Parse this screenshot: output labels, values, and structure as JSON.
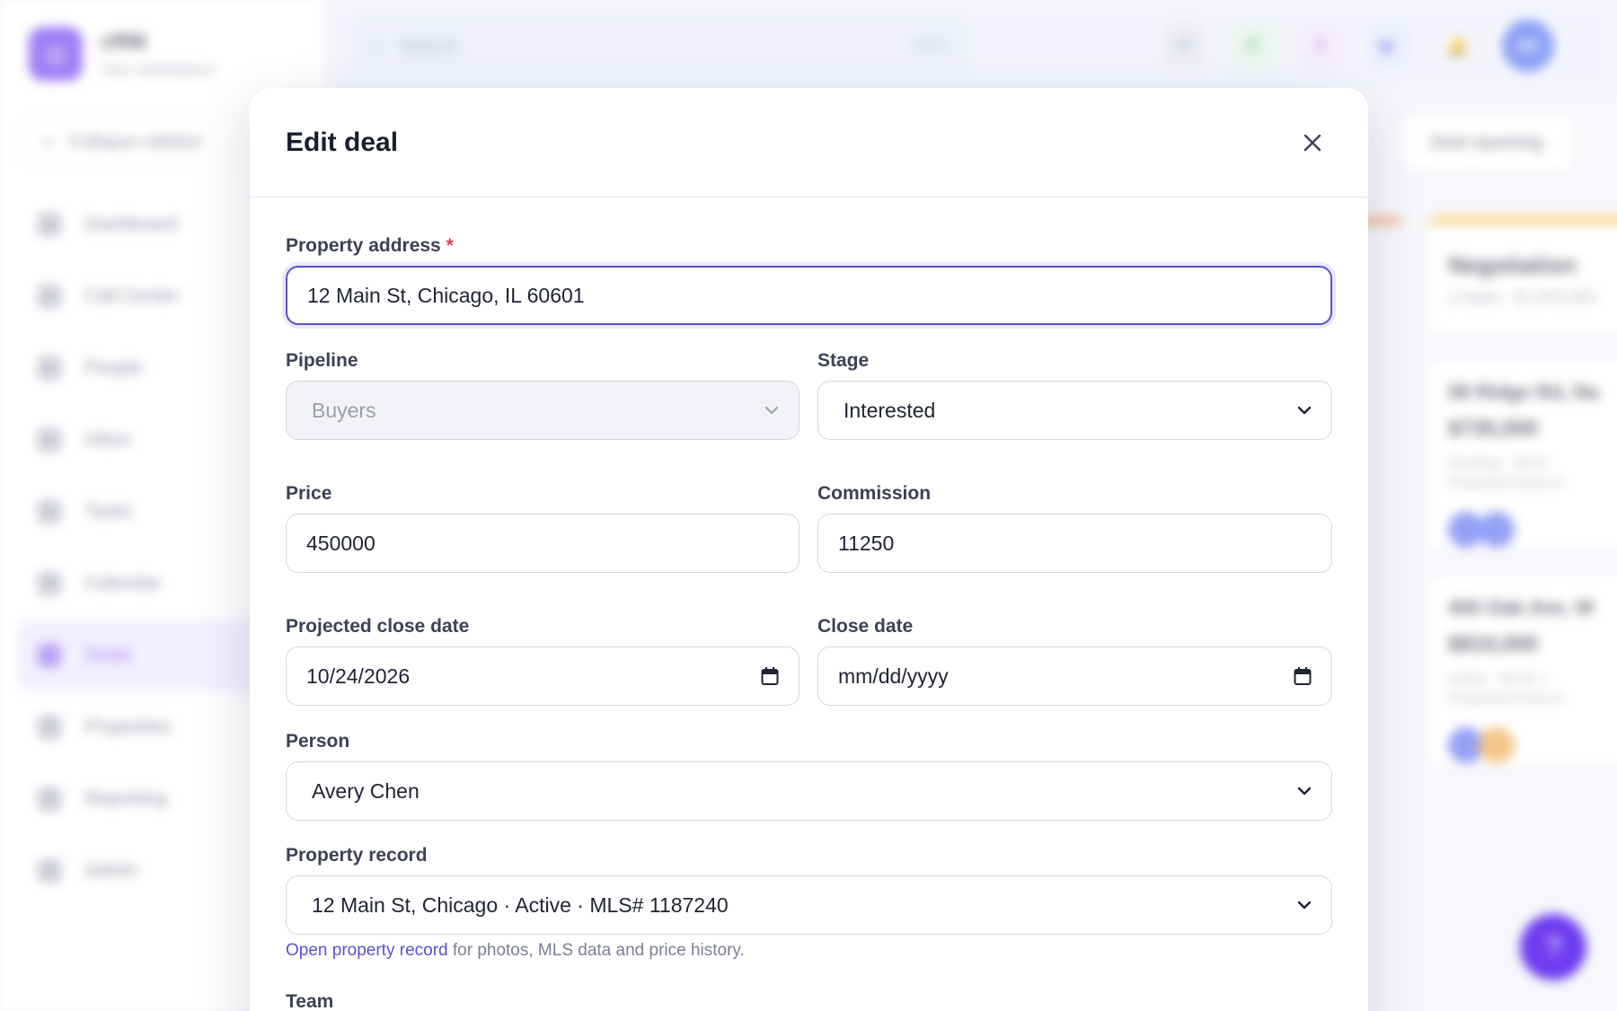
{
  "background": {
    "brand": {
      "name": "cRM",
      "subtitle": "Your workspace"
    },
    "collapse_label": "Collapse sidebar",
    "nav": [
      {
        "label": "Dashboard",
        "icon": "grid-icon"
      },
      {
        "label": "Call Center",
        "icon": "phone-icon"
      },
      {
        "label": "People",
        "icon": "people-icon"
      },
      {
        "label": "Inbox",
        "icon": "inbox-icon"
      },
      {
        "label": "Tasks",
        "icon": "tasks-icon"
      },
      {
        "label": "Calendar",
        "icon": "calendar-icon"
      },
      {
        "label": "Deals",
        "icon": "deals-icon",
        "active": true
      },
      {
        "label": "Properties",
        "icon": "home-icon"
      },
      {
        "label": "Reporting",
        "icon": "chart-icon"
      },
      {
        "label": "Admin",
        "icon": "wrench-icon"
      }
    ],
    "search": {
      "placeholder": "Search",
      "shortcut": "Ctrl K"
    },
    "user_initials": "AC",
    "deal_reporting_label": "Deal reporting",
    "column": {
      "title": "Negotiation",
      "meta": "2 deals · $1,045,000"
    },
    "cards": [
      {
        "title": "58 Ridge Rd, Na",
        "price": "$735,000",
        "meta": "Pending · 58 Ri",
        "meta2": "Projected Close D"
      },
      {
        "title": "400 Oak Ave, W",
        "price": "$810,000",
        "meta": "Active · 58 W 1",
        "meta2": "Projected Close D"
      }
    ],
    "help_label": "?"
  },
  "modal": {
    "title": "Edit deal",
    "fields": {
      "property_address": {
        "label": "Property address",
        "required_mark": "*",
        "value": "12 Main St, Chicago, IL 60601"
      },
      "pipeline": {
        "label": "Pipeline",
        "value": "Buyers"
      },
      "stage": {
        "label": "Stage",
        "value": "Interested"
      },
      "price": {
        "label": "Price",
        "value": "450000"
      },
      "commission": {
        "label": "Commission",
        "value": "11250"
      },
      "projected_close_date": {
        "label": "Projected close date",
        "value": "10/24/2026"
      },
      "close_date": {
        "label": "Close date",
        "value": "mm/dd/yyyy"
      },
      "person": {
        "label": "Person",
        "value": "Avery Chen"
      },
      "property_record": {
        "label": "Property record",
        "value": "12 Main St, Chicago · Active · MLS# 1187240"
      },
      "team": {
        "label": "Team"
      }
    },
    "helper": {
      "link": "Open property record",
      "rest": " for photos, MLS data and price history."
    }
  },
  "colors": {
    "accent": "#5b4fd6",
    "brand": "#6d3cf0",
    "required": "#e0405a"
  }
}
